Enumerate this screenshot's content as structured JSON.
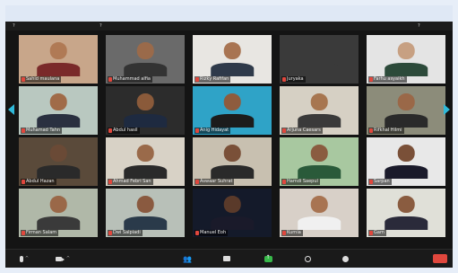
{
  "top_strip_names": [
    "?",
    "?",
    "",
    "",
    "",
    "?"
  ],
  "tiles": [
    {
      "name": "Sahid maulana",
      "bg": "#c8a68a",
      "skin": "#b07a55",
      "shirt": "#7a2a2a"
    },
    {
      "name": "Muhammad alfia",
      "bg": "#6a6a6a",
      "skin": "#9a6a4a",
      "shirt": "#333333"
    },
    {
      "name": "Rizky Rafifan",
      "bg": "#e8e6e2",
      "skin": "#a87452",
      "shirt": "#2f3a4a"
    },
    {
      "name": "Juryaka",
      "bg": "#3a3a3a",
      "skin": "#3a3a3a",
      "shirt": "#3a3a3a"
    },
    {
      "name": "Farhu asyaikh",
      "bg": "#e4e4e4",
      "skin": "#c7a082",
      "shirt": "#2c4a3a"
    },
    {
      "name": "Muhamad Tahn",
      "bg": "#b9c8c0",
      "skin": "#a06b48",
      "shirt": "#2a3040"
    },
    {
      "name": "Abdul hasil",
      "bg": "#2c2c2c",
      "skin": "#8a5a3a",
      "shirt": "#1e2a40"
    },
    {
      "name": "Anig Hidayat",
      "bg": "#2fa3c7",
      "skin": "#8e5c3e",
      "shirt": "#1c1c1c"
    },
    {
      "name": "Arjuna Caesars",
      "bg": "#d6d0c4",
      "skin": "#a77650",
      "shirt": "#3a3a3a"
    },
    {
      "name": "Rifkhal Hilmi",
      "bg": "#8c8c7a",
      "skin": "#9a6848",
      "shirt": "#2a2a2a"
    },
    {
      "name": "Abdul Hazan",
      "bg": "#5a4a3a",
      "skin": "#6a4a36",
      "shirt": "#2a2a2a"
    },
    {
      "name": "Ahmad Febri San",
      "bg": "#d8d2c6",
      "skin": "#9a6a4a",
      "shirt": "#2a2a2a"
    },
    {
      "name": "Aswaar Suhrat",
      "bg": "#c8c0b0",
      "skin": "#7a5038",
      "shirt": "#2a2a2a"
    },
    {
      "name": "Hamdi Saepul",
      "bg": "#a8c8a0",
      "skin": "#8a5c40",
      "shirt": "#2a5a3a"
    },
    {
      "name": "Sarpan",
      "bg": "#e8e8e8",
      "skin": "#7a5038",
      "shirt": "#1a1a2a"
    },
    {
      "name": "Firman Salam",
      "bg": "#b0b8a8",
      "skin": "#9a6848",
      "shirt": "#3a3a3a"
    },
    {
      "name": "Dwi Salpiadi",
      "bg": "#b8c0b8",
      "skin": "#8a5a40",
      "shirt": "#2a3a4a"
    },
    {
      "name": "Manuel Eoh",
      "bg": "#141a2a",
      "skin": "#5a3a2a",
      "shirt": "#1a1a2a"
    },
    {
      "name": "Kurnia",
      "bg": "#d8d0c8",
      "skin": "#a87452",
      "shirt": "#f0f0f0"
    },
    {
      "name": "Gam",
      "bg": "#e0e0d8",
      "skin": "#8a5c40",
      "shirt": "#2a2a3a"
    }
  ],
  "toolbar": {
    "participants_count": "",
    "end_label": ""
  },
  "colors": {
    "arrow": "#2fb9d9",
    "share": "#38b94a",
    "end": "#e0473d"
  }
}
